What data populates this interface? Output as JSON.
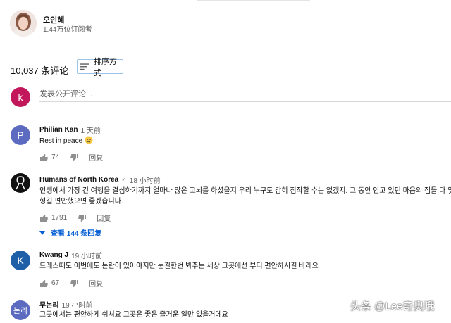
{
  "channel": {
    "name": "오인혜",
    "subscribers": "1.44万位订阅者",
    "avatar_icon": "channel-avatar-photo"
  },
  "comments_header": {
    "count": "10,037 条评论",
    "sort_label": "排序方式"
  },
  "add_comment": {
    "avatar_letter": "k",
    "avatar_color": "#c2185b",
    "placeholder": "发表公开评论..."
  },
  "comments": [
    {
      "author": "Philian Kan",
      "time": "1 天前",
      "avatar_letter": "P",
      "avatar_color": "#5c6bc0",
      "text": "Rest in peace",
      "likes": "74",
      "reply_label": "回复"
    },
    {
      "author": "Humans of North Korea",
      "time": "18 小时前",
      "verified": true,
      "avatar_icon": "ribbon-logo",
      "avatar_color": "#111111",
      "text": "인생에서 가장 긴 여행을 결심하기까지 얼마나 많은 고뇌를 하셨을지 우리 누구도 감히 짐작할 수는 없겠지. 그 동안 안고 있던 마음의 짐들 다 잊고 마",
      "text_line2": "형길 편안했으면 좋겠습니다.",
      "likes": "1791",
      "reply_label": "回复",
      "view_replies": "查看 144 条回复"
    },
    {
      "author": "Kwang J",
      "time": "19 小时前",
      "avatar_letter": "K",
      "avatar_color": "#1e5fa8",
      "text": "드레스때도 이번에도 논란이 있어야지만 눈길한번 봐주는 세상 그곳에선 부디 편안하시길 바래요",
      "likes": "67",
      "reply_label": "回复"
    },
    {
      "author": "무논리",
      "time": "19 小时前",
      "avatar_letter": "논리",
      "avatar_color": "#5c6bc0",
      "text": "그곳에서는 편안하게 쉬셔요 그곳은 좋은 즐거운 일만 있을거에요"
    }
  ],
  "watermark": "头条 @Lee奇奥哦"
}
